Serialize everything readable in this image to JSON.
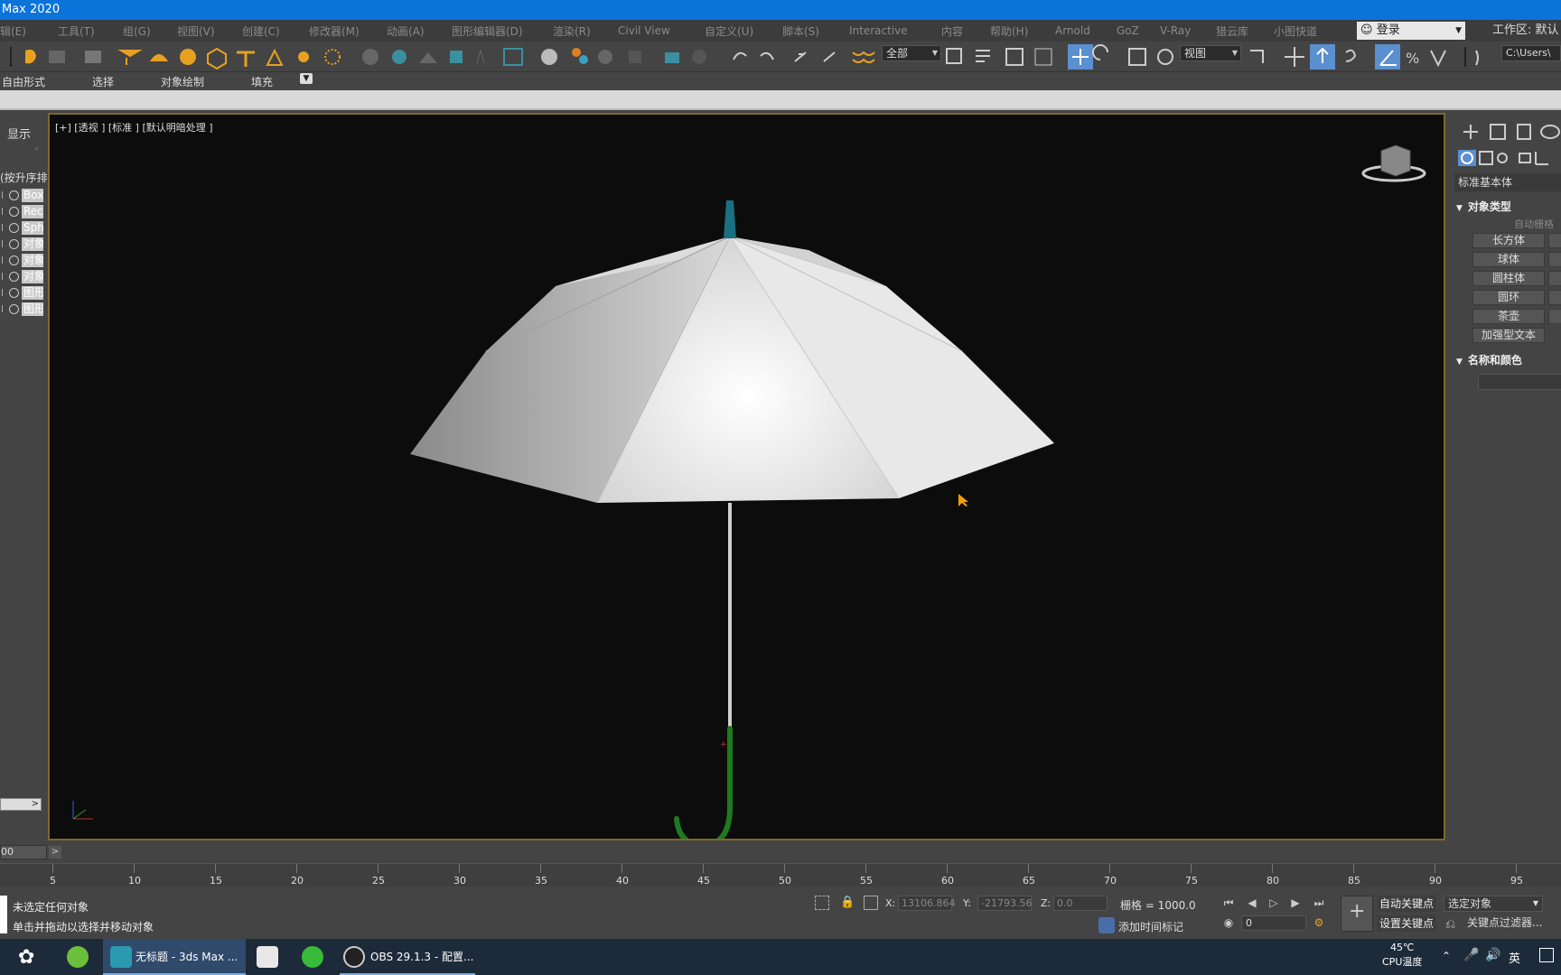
{
  "window": {
    "title": "Max 2020"
  },
  "menu": [
    "辑(E)",
    "工具(T)",
    "组(G)",
    "视图(V)",
    "创建(C)",
    "修改器(M)",
    "动画(A)",
    "图形编辑器(D)",
    "渲染(R)",
    "Civil View",
    "自定义(U)",
    "脚本(S)",
    "Interactive",
    "内容",
    "帮助(H)",
    "Arnold",
    "GoZ",
    "V-Ray",
    "猎云库",
    "小图快道"
  ],
  "login": {
    "label": "登录"
  },
  "workspace": {
    "label": "工作区: 默认"
  },
  "toolbar": {
    "selection_filter": "全部",
    "ref_coord": "视图",
    "path_field": "C:\\Users\\"
  },
  "ribbon": {
    "tabs": [
      "自由形式",
      "选择",
      "对象绘制",
      "填充"
    ]
  },
  "scene_explorer": {
    "display_label": "显示",
    "sort_label": "(按升序排",
    "items": [
      "Box",
      "Rec",
      "Sph",
      "对象",
      "对象",
      "对象",
      "图形",
      "图形"
    ]
  },
  "viewport": {
    "label": "[+] [透视 ] [标准 ] [默认明暗处理 ]",
    "colors": {
      "canopy": "#f2f2f2",
      "tip": "#1a6f80",
      "handle": "#1e7a1e",
      "shaft": "#d0d0d0"
    }
  },
  "command_panel": {
    "category": "标准基本体",
    "object_type_title": "对象类型",
    "autogrid": "自动栅格",
    "buttons": [
      "长方体",
      "球体",
      "圆柱体",
      "圆环",
      "茶壶",
      "加强型文本"
    ],
    "name_color_title": "名称和颜色"
  },
  "timeline": {
    "frame_box": "00",
    "ticks": [
      "5",
      "10",
      "15",
      "20",
      "25",
      "30",
      "35",
      "40",
      "45",
      "50",
      "55",
      "60",
      "65",
      "70",
      "75",
      "80",
      "85",
      "90",
      "95"
    ]
  },
  "status": {
    "line1": "未选定任何对象",
    "line2": "单击并拖动以选择并移动对象",
    "x_label": "X:",
    "x_value": "13106.864",
    "y_label": "Y:",
    "y_value": "-21793.56",
    "z_label": "Z:",
    "z_value": "0.0",
    "grid": "栅格 = 1000.0",
    "add_time_tag": "添加时间标记",
    "frame_value": "0",
    "auto_key": "自动关键点",
    "set_key": "设置关键点",
    "selected_dd": "选定对象",
    "key_filter": "关键点过滤器..."
  },
  "taskbar": {
    "app1": "无标题 - 3ds Max ...",
    "app2": "OBS 29.1.3 - 配置...",
    "temp": "45℃",
    "temp_label": "CPU温度",
    "lang": "英"
  }
}
